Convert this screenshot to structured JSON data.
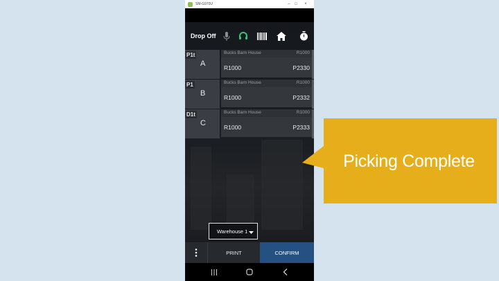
{
  "window": {
    "title": "SM-G970U"
  },
  "toolbar": {
    "title": "Drop Off",
    "icons": [
      "microphone-icon",
      "headset-icon",
      "barcode-icon",
      "home-icon",
      "stopwatch-icon"
    ],
    "headset_color": "#2ecc71"
  },
  "picks": [
    {
      "tag": "P1t",
      "letter": "A",
      "location": "Bucks Barn House",
      "code": "R1000",
      "qty": "R1000",
      "pallet": "P2330"
    },
    {
      "tag": "P1",
      "letter": "B",
      "location": "Bucks Barn House",
      "code": "R1000",
      "qty": "R1000",
      "pallet": "P2332"
    },
    {
      "tag": "D1t",
      "letter": "C",
      "location": "Bucks Barn House",
      "code": "R1000",
      "qty": "R1000",
      "pallet": "P2333"
    }
  ],
  "warehouse_select": {
    "value": "Warehouse 1"
  },
  "actions": {
    "print_label": "PRINT",
    "confirm_label": "CONFIRM",
    "confirm_color": "#245082"
  },
  "callout": {
    "text": "Picking Complete",
    "color": "#e6ae1a"
  },
  "background_color": "#d5e3ee"
}
